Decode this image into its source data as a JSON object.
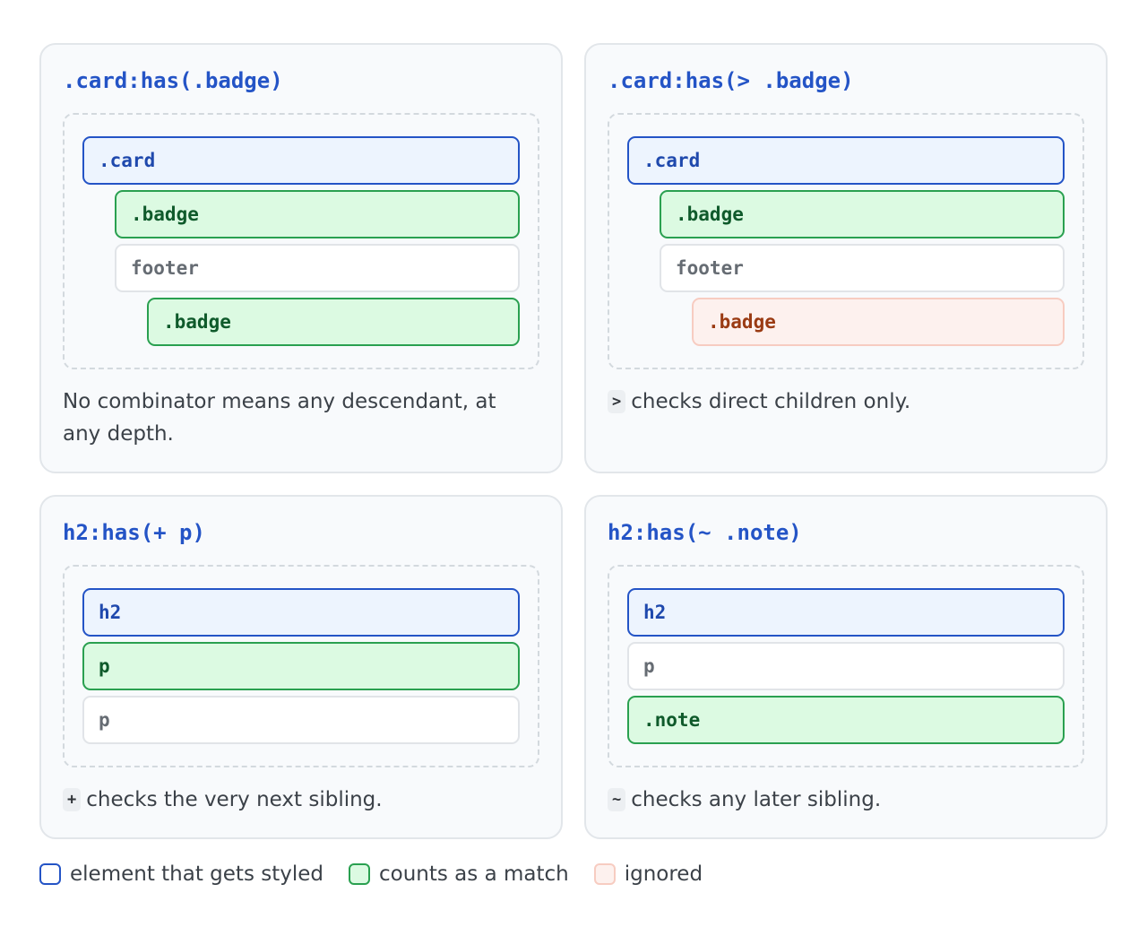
{
  "panels": [
    {
      "selector": ".card:has(.badge)",
      "nodes": [
        {
          "label": ".card",
          "state": "styled",
          "depth": 0
        },
        {
          "label": ".badge",
          "state": "match",
          "depth": 1
        },
        {
          "label": "footer",
          "state": "neutral",
          "depth": 1
        },
        {
          "label": ".badge",
          "state": "match",
          "depth": 2
        }
      ],
      "caption_code": "",
      "caption": "No combinator means any descendant, at any depth."
    },
    {
      "selector": ".card:has(> .badge)",
      "nodes": [
        {
          "label": ".card",
          "state": "styled",
          "depth": 0
        },
        {
          "label": ".badge",
          "state": "match",
          "depth": 1
        },
        {
          "label": "footer",
          "state": "neutral",
          "depth": 1
        },
        {
          "label": ".badge",
          "state": "ignored",
          "depth": 2
        }
      ],
      "caption_code": ">",
      "caption": "checks direct children only."
    },
    {
      "selector": "h2:has(+ p)",
      "nodes": [
        {
          "label": "h2",
          "state": "styled",
          "depth": 0
        },
        {
          "label": "p",
          "state": "match",
          "depth": 0
        },
        {
          "label": "p",
          "state": "neutral",
          "depth": 0
        }
      ],
      "caption_code": "+",
      "caption": "checks the very next sibling."
    },
    {
      "selector": "h2:has(~ .note)",
      "nodes": [
        {
          "label": "h2",
          "state": "styled",
          "depth": 0
        },
        {
          "label": "p",
          "state": "neutral",
          "depth": 0
        },
        {
          "label": ".note",
          "state": "match",
          "depth": 0
        }
      ],
      "caption_code": "~",
      "caption": "checks any later sibling."
    }
  ],
  "legend": [
    {
      "label": "element that gets styled",
      "state": "styled"
    },
    {
      "label": "counts as a match",
      "state": "match"
    },
    {
      "label": "ignored",
      "state": "ignored"
    }
  ],
  "colors": {
    "styled": "#2454c6",
    "match": "#2aa050",
    "ignored": "#f7ccc1"
  }
}
